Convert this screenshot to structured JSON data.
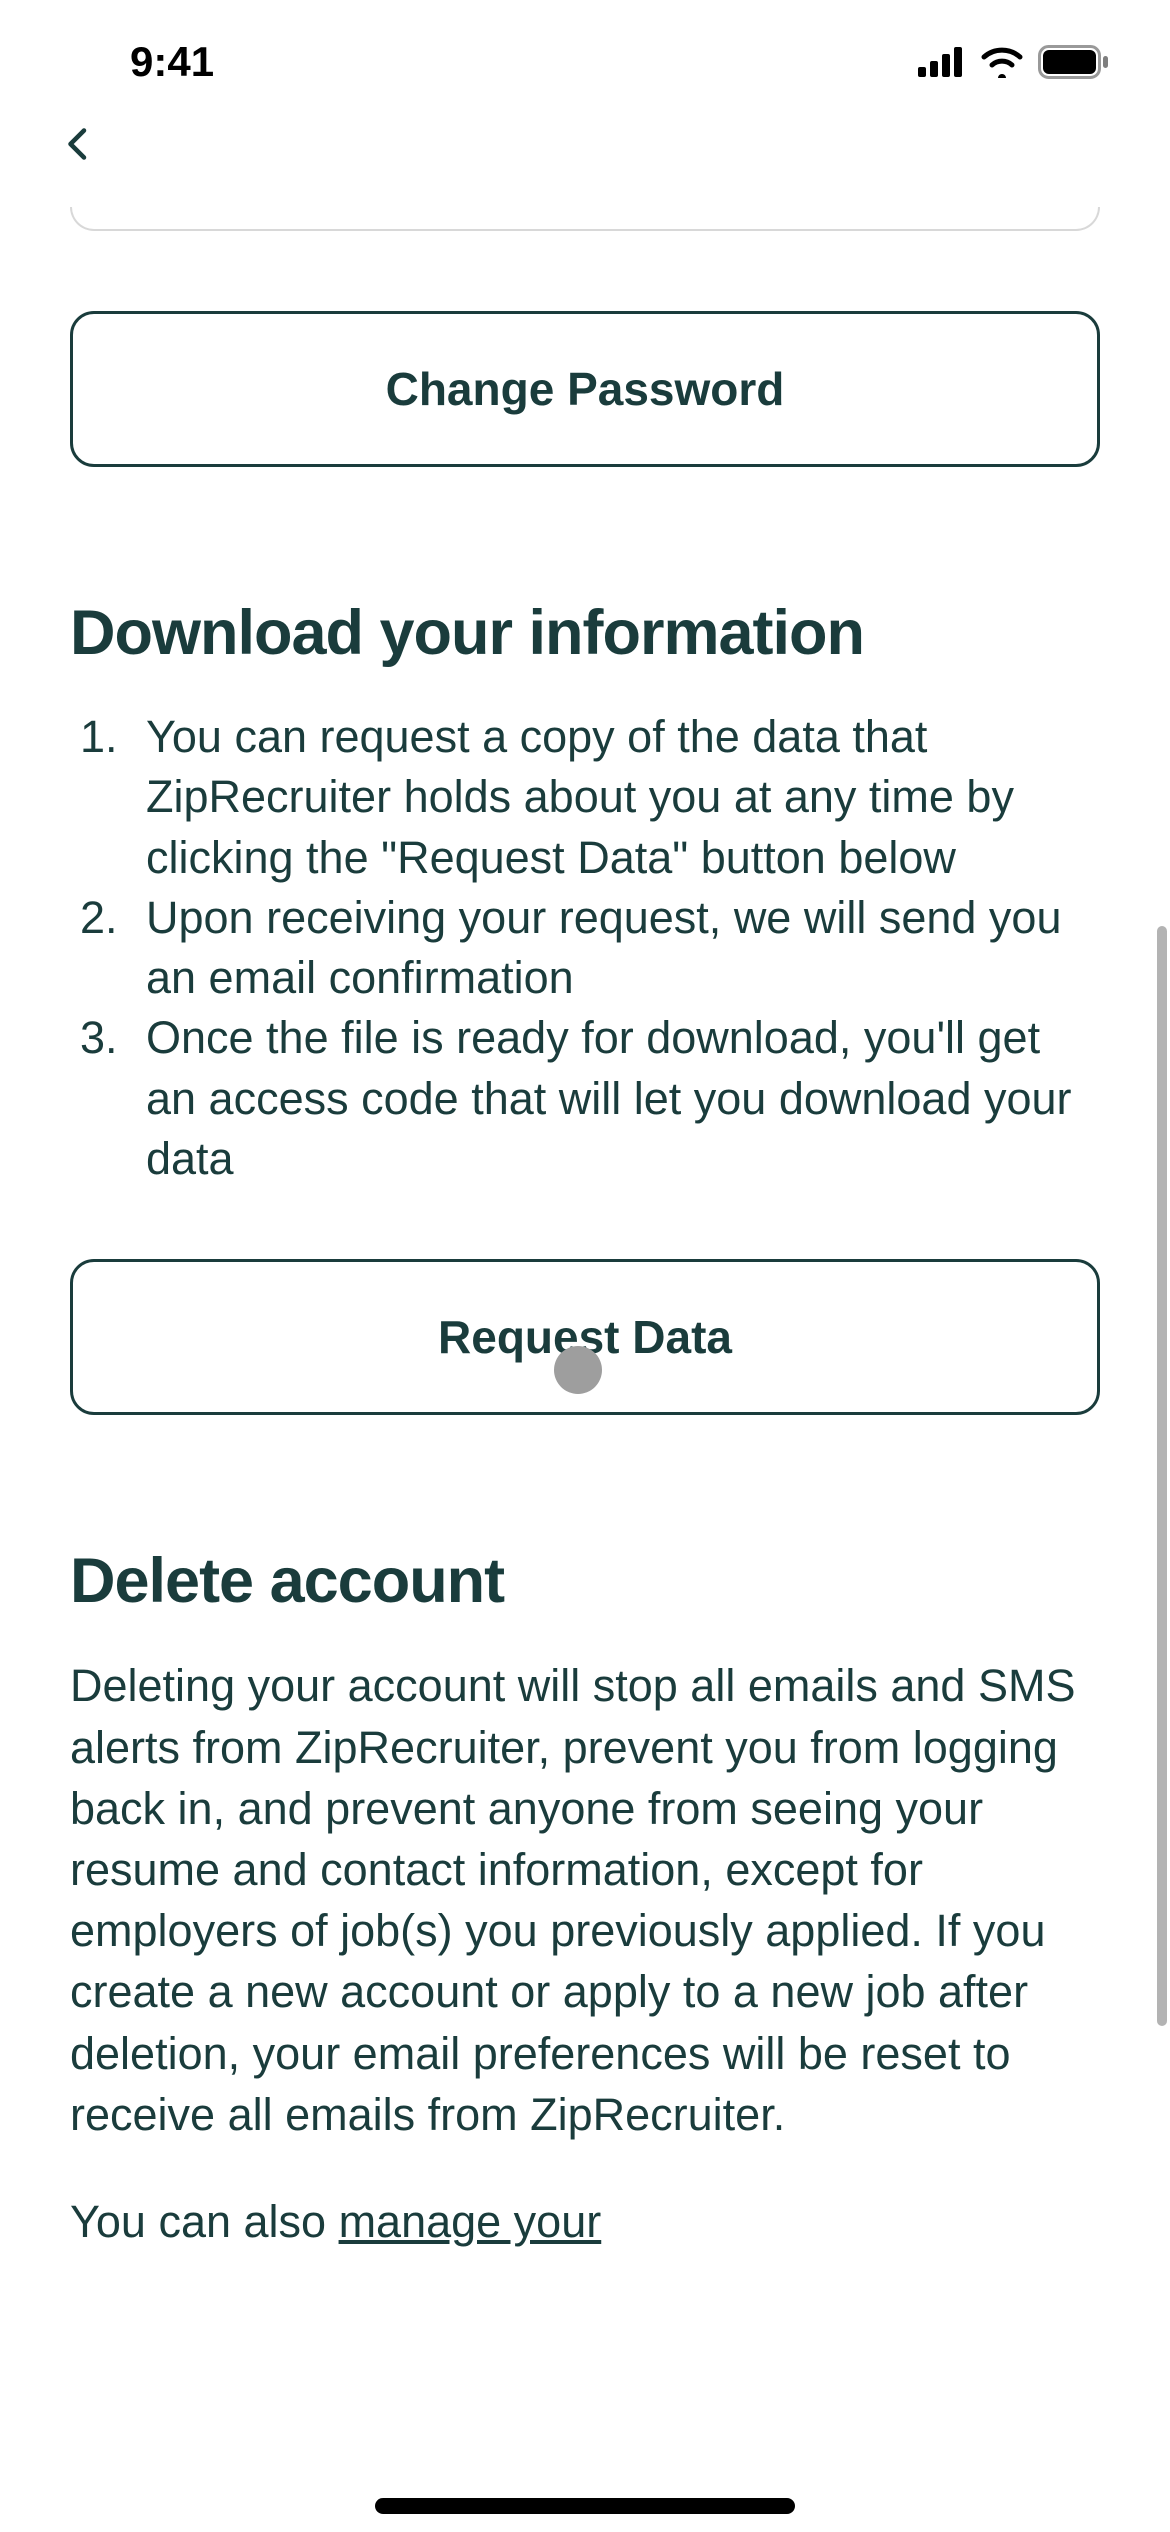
{
  "statusBar": {
    "time": "9:41"
  },
  "buttons": {
    "changePassword": "Change Password",
    "requestData": "Request Data"
  },
  "sections": {
    "download": {
      "title": "Download your information",
      "items": [
        "You can request a copy of the data that ZipRecruiter holds about you at any time by clicking the \"Request Data\" button below",
        "Upon receiving your request, we will send you an email confirmation",
        "Once the file is ready for download, you'll get an access code that will let you download your data"
      ]
    },
    "delete": {
      "title": "Delete account",
      "body": "Deleting your account will stop all emails and SMS alerts from ZipRecruiter, prevent you from logging back in, and prevent anyone from seeing your resume and contact information, except for employers of job(s) you previously applied. If you create a new account or apply to a new job after deletion, your email preferences will be reset to receive all emails from ZipRecruiter.",
      "linkPrefix": "You can also ",
      "linkText": "manage your"
    }
  }
}
